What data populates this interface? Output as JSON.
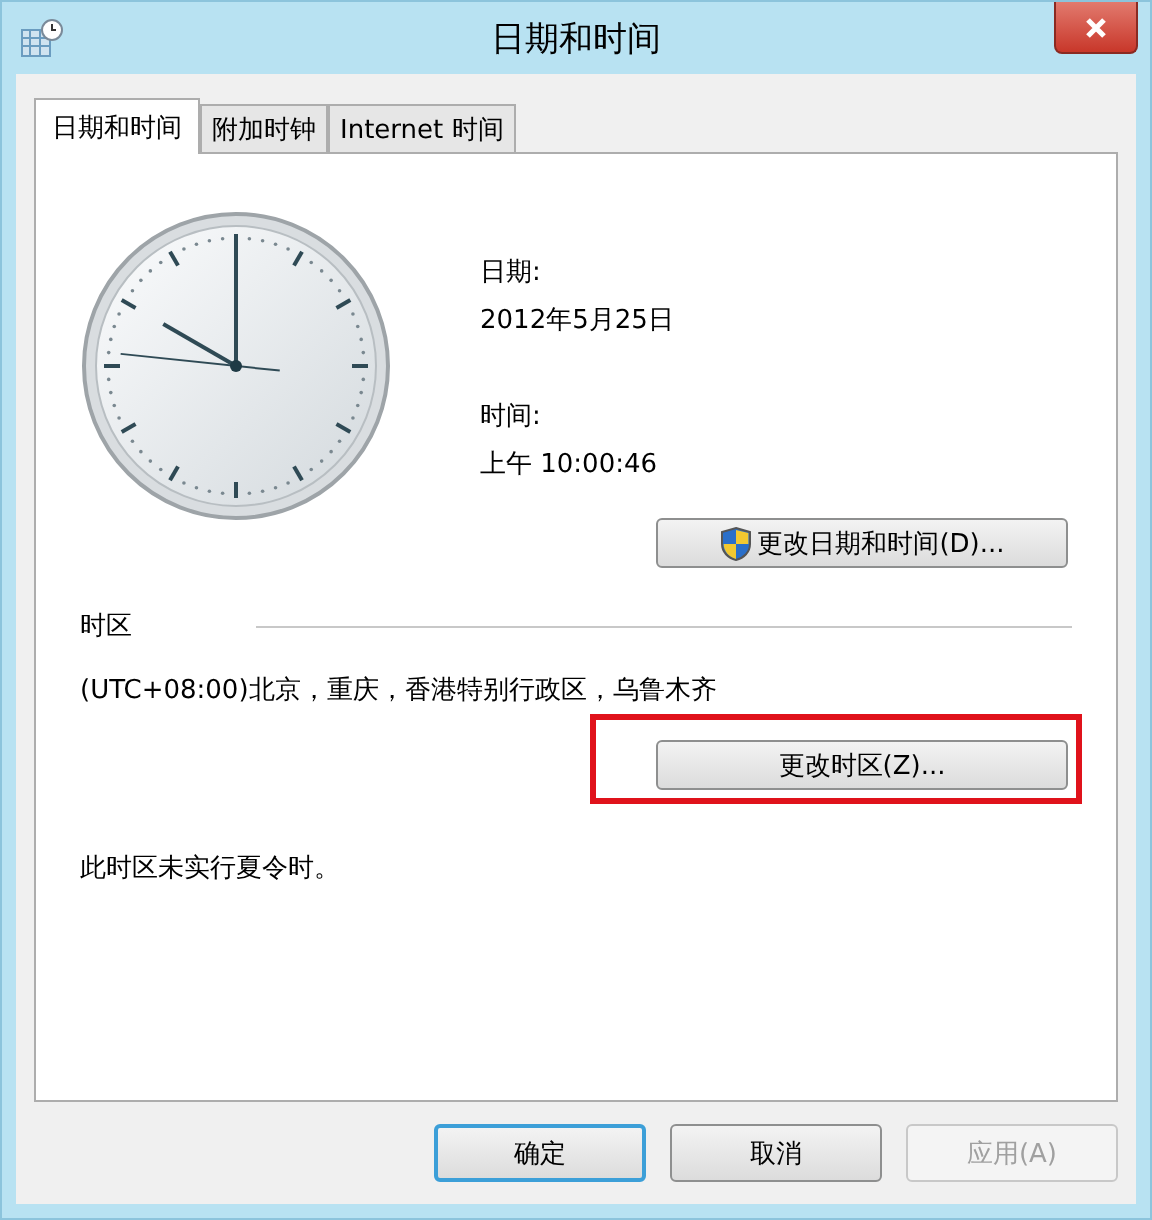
{
  "window": {
    "title": "日期和时间"
  },
  "tabs": [
    {
      "label": "日期和时间",
      "selected": true
    },
    {
      "label": "附加时钟",
      "selected": false
    },
    {
      "label": "Internet 时间",
      "selected": false
    }
  ],
  "date": {
    "label": "日期:",
    "value": "2012年5月25日"
  },
  "time": {
    "label": "时间:",
    "value": "上午 10:00:46"
  },
  "change_datetime_button": {
    "label": "更改日期和时间(D)...",
    "shield": true
  },
  "timezone": {
    "heading": "时区",
    "value": "(UTC+08:00)北京，重庆，香港特别行政区，乌鲁木齐",
    "change_button": {
      "label": "更改时区(Z)...",
      "highlighted": true
    },
    "dst_note": "此时区未实行夏令时。"
  },
  "buttons": [
    {
      "label": "确定",
      "default": true,
      "disabled": false
    },
    {
      "label": "取消",
      "default": false,
      "disabled": false
    },
    {
      "label": "应用(A)",
      "default": false,
      "disabled": true
    }
  ]
}
